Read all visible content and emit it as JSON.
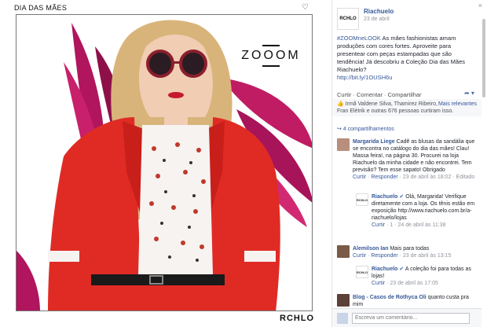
{
  "photo": {
    "title": "DIA DAS MÃES",
    "brand_overlay": "ZOOOM",
    "footer_brand": "RCHLO"
  },
  "post": {
    "page_name": "Riachuelo",
    "date": "23 de abril",
    "logo_text": "RCHLO",
    "hashtag": "#ZOOMneLOOK",
    "text": " As mães fashionistas amam produções com cores fortes. Aproveite para presentear com peças estampadas que são tendência! Já descobriu a Coleção Dia das Mães Riachuelo?",
    "link": "http://bit.ly/1OUSH6u"
  },
  "actions": {
    "like": "Curtir",
    "comment": "Comentar",
    "share": "Compartilhar"
  },
  "likes": {
    "text": "Irmã Valdene Silva, Thamirez Ribeiro, Fran Elétrik e outras 676 pessoas curtiram isso.",
    "sort": "Mais relevantes"
  },
  "shares": "4 compartilhamentos",
  "comments": [
    {
      "name": "Margarida Liege",
      "text": "Cadê as blusas da sandália que se encontra no catálogo do dia das mães! Clau! Massa feira!, na página 30. Procurei na loja Riachuelo da minha cidade e não encontrei. Tem previsão? Tem esse sapato! Obrigado",
      "meta_like": "Curtir",
      "meta_reply": "Responder",
      "meta_date": "23 de abril às 18:02",
      "edited": "Editado"
    },
    {
      "name": "Riachuelo",
      "text": "Olá, Margarida! Verifique diretamente com a loja. Os tênis estão em exposição http://www.riachuelo.com.br/a-riachuelo/lojas",
      "meta_like": "Curtir",
      "meta_count": "1",
      "meta_date": "24 de abril às 11:38"
    },
    {
      "name": "Alemilson Ian",
      "text": "Mais para todas",
      "meta_like": "Curtir",
      "meta_reply": "Responder",
      "meta_date": "23 de abril às 13:15"
    },
    {
      "name": "Riachuelo",
      "text": "A coleção foi para todas as lojas!",
      "meta_like": "Curtir",
      "meta_date": "23 de abril às 17:05"
    },
    {
      "name": "Blog - Casos de Rothyca Oli",
      "text": "quanto custa pra mim"
    }
  ],
  "write_placeholder": "Escreva um comentário...",
  "colors": {
    "link": "#365899",
    "meta": "#90949c",
    "coat": "#e02b25",
    "leaves": "#b0155d"
  }
}
